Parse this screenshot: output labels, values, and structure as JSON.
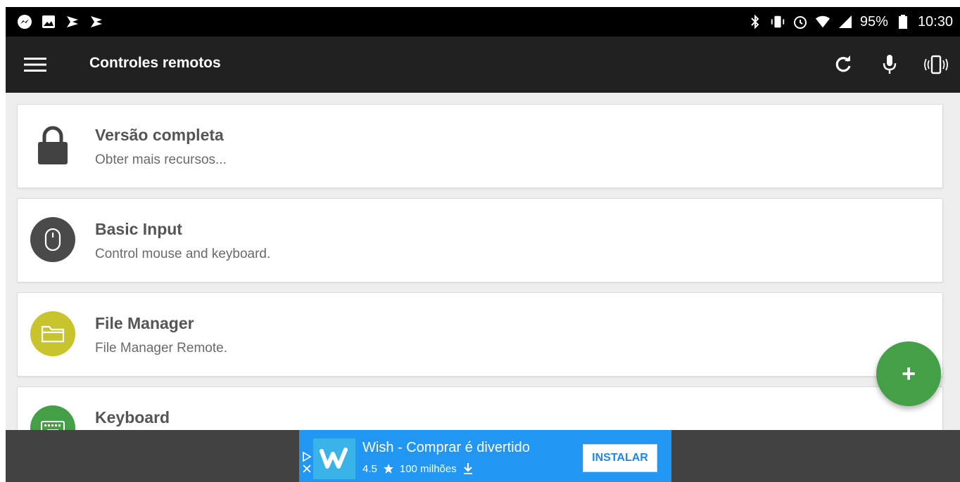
{
  "status_bar": {
    "battery": "95%",
    "time": "10:30",
    "left_icons": [
      "messenger-icon",
      "gallery-icon",
      "snooze-icon",
      "snooze-icon"
    ],
    "right_icons": [
      "bluetooth-icon",
      "vibrate-icon",
      "alarm-icon",
      "wifi-icon",
      "cell-signal-icon",
      "battery-icon"
    ]
  },
  "app_bar": {
    "title": "Controles remotos",
    "menu_icon": "hamburger-icon",
    "actions": [
      "refresh-icon",
      "microphone-icon",
      "phone-vibrate-icon"
    ]
  },
  "remotes": [
    {
      "title": "Versão completa",
      "subtitle": "Obter mais recursos...",
      "icon": "lock-icon",
      "color": "#424242"
    },
    {
      "title": "Basic Input",
      "subtitle": "Control mouse and keyboard.",
      "icon": "mouse-icon",
      "color": "#4a4a4a"
    },
    {
      "title": "File Manager",
      "subtitle": "File Manager Remote.",
      "icon": "folder-icon",
      "color": "#c8c42e"
    },
    {
      "title": "Keyboard",
      "subtitle": "",
      "icon": "keyboard-icon",
      "color": "#43a047"
    }
  ],
  "fab": {
    "label": "+",
    "color": "#43a047"
  },
  "ad": {
    "title": "Wish - Comprar é divertido",
    "rating": "4.5",
    "installs": "100 milhões",
    "install_label": "INSTALAR",
    "background": "#2196f3"
  },
  "colors": {
    "app_bar": "#212121",
    "status_bar": "#000000",
    "list_background": "#eeeeee"
  }
}
